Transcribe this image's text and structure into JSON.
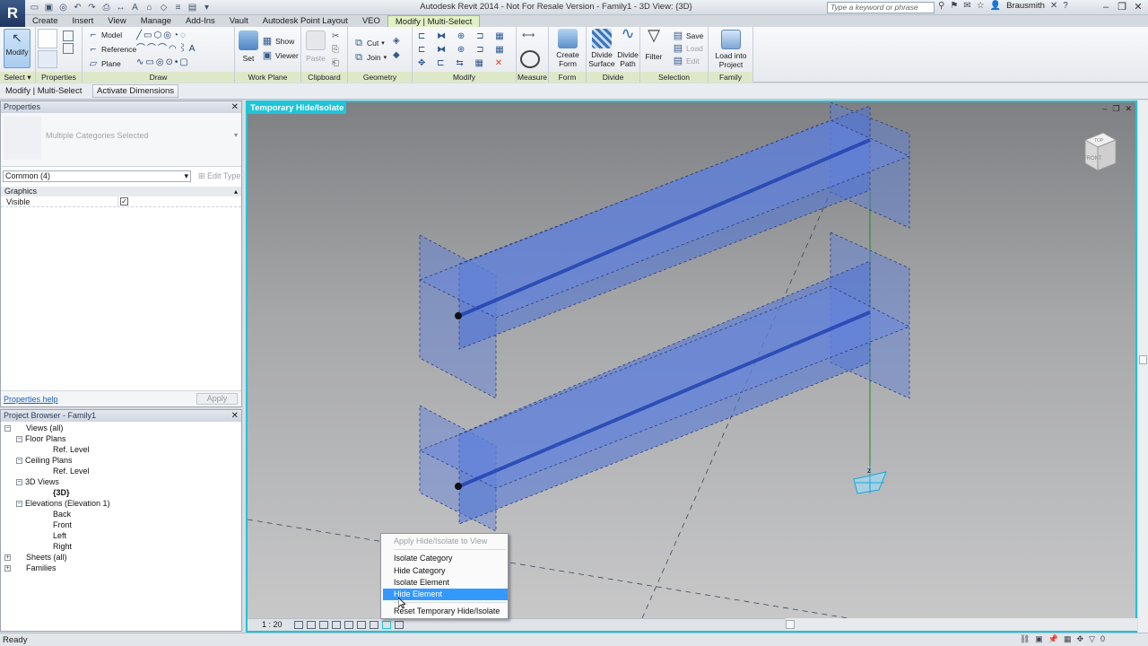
{
  "app": {
    "logo": "R",
    "window_title": "Autodesk Revit 2014 -  Not For Resale Version -     Family1 - 3D View: {3D}",
    "search_placeholder": "Type a keyword or phrase",
    "username": "Brausmith",
    "min_label": "–",
    "max_label": "❐",
    "close_label": "✕"
  },
  "tabs": [
    "Create",
    "Insert",
    "View",
    "Manage",
    "Add-Ins",
    "Vault",
    "Autodesk Point Layout",
    "VEO",
    "Modify | Multi-Select"
  ],
  "active_tab_index": 8,
  "ribbon": {
    "modify_label": "Modify",
    "select_label": "Select ▾",
    "properties_panel": "Properties",
    "draw_panel": "Draw",
    "draw_items": [
      "Model",
      "Reference",
      "Plane"
    ],
    "workplane_panel": "Work Plane",
    "set_label": "Set",
    "show_label": "Show",
    "viewer_label": "Viewer",
    "clipboard_panel": "Clipboard",
    "paste_label": "Paste",
    "geometry_panel": "Geometry",
    "cut_label": "Cut",
    "join_label": "Join",
    "modify_panel": "Modify",
    "measure_panel": "Measure",
    "form_panel": "Form",
    "create_form_label": "Create\nForm",
    "divide_panel": "Divide",
    "divide_surface_label": "Divide\nSurface",
    "divide_path_label": "Divide\nPath",
    "selection_panel": "Selection",
    "filter_label": "Filter",
    "save_label": "Save",
    "load_label": "Load",
    "edit_label": "Edit",
    "family_editor_panel": "Family Editor",
    "load_into_project_label": "Load into\nProject"
  },
  "options_bar": {
    "context": "Modify | Multi-Select",
    "activate_dimensions": "Activate Dimensions"
  },
  "properties": {
    "title": "Properties",
    "type_name": "Multiple Categories Selected",
    "filter": "Common (4)",
    "edit_type": "Edit Type",
    "group": "Graphics",
    "param_label": "Visible",
    "param_checked": "✓",
    "help_link": "Properties help",
    "apply": "Apply"
  },
  "browser": {
    "title": "Project Browser - Family1",
    "items": [
      {
        "label": "Views (all)",
        "level": 0,
        "toggle": "−"
      },
      {
        "label": "Floor Plans",
        "level": 1,
        "toggle": "−"
      },
      {
        "label": "Ref. Level",
        "level": 2,
        "toggle": ""
      },
      {
        "label": "Ceiling Plans",
        "level": 1,
        "toggle": "−"
      },
      {
        "label": "Ref. Level",
        "level": 2,
        "toggle": ""
      },
      {
        "label": "3D Views",
        "level": 1,
        "toggle": "−"
      },
      {
        "label": "{3D}",
        "level": 2,
        "toggle": "",
        "bold": true
      },
      {
        "label": "Elevations (Elevation 1)",
        "level": 1,
        "toggle": "−"
      },
      {
        "label": "Back",
        "level": 2,
        "toggle": ""
      },
      {
        "label": "Front",
        "level": 2,
        "toggle": ""
      },
      {
        "label": "Left",
        "level": 2,
        "toggle": ""
      },
      {
        "label": "Right",
        "level": 2,
        "toggle": ""
      },
      {
        "label": "Sheets (all)",
        "level": 0,
        "toggle": "+"
      },
      {
        "label": "Families",
        "level": 0,
        "toggle": "+"
      }
    ]
  },
  "viewport": {
    "temp_label": "Temporary Hide/Isolate",
    "viewcube_top": "TOP",
    "viewcube_front": "FRONT",
    "scale": "1 : 20",
    "highlight_color": "#1fc4d6"
  },
  "context_menu": {
    "header": "Apply Hide/Isolate to View",
    "items": [
      "Isolate Category",
      "Hide Category",
      "Isolate Element",
      "Hide Element",
      "Reset Temporary Hide/Isolate"
    ],
    "selected_index": 3
  },
  "status": {
    "text": "Ready",
    "selection_count": "0"
  }
}
